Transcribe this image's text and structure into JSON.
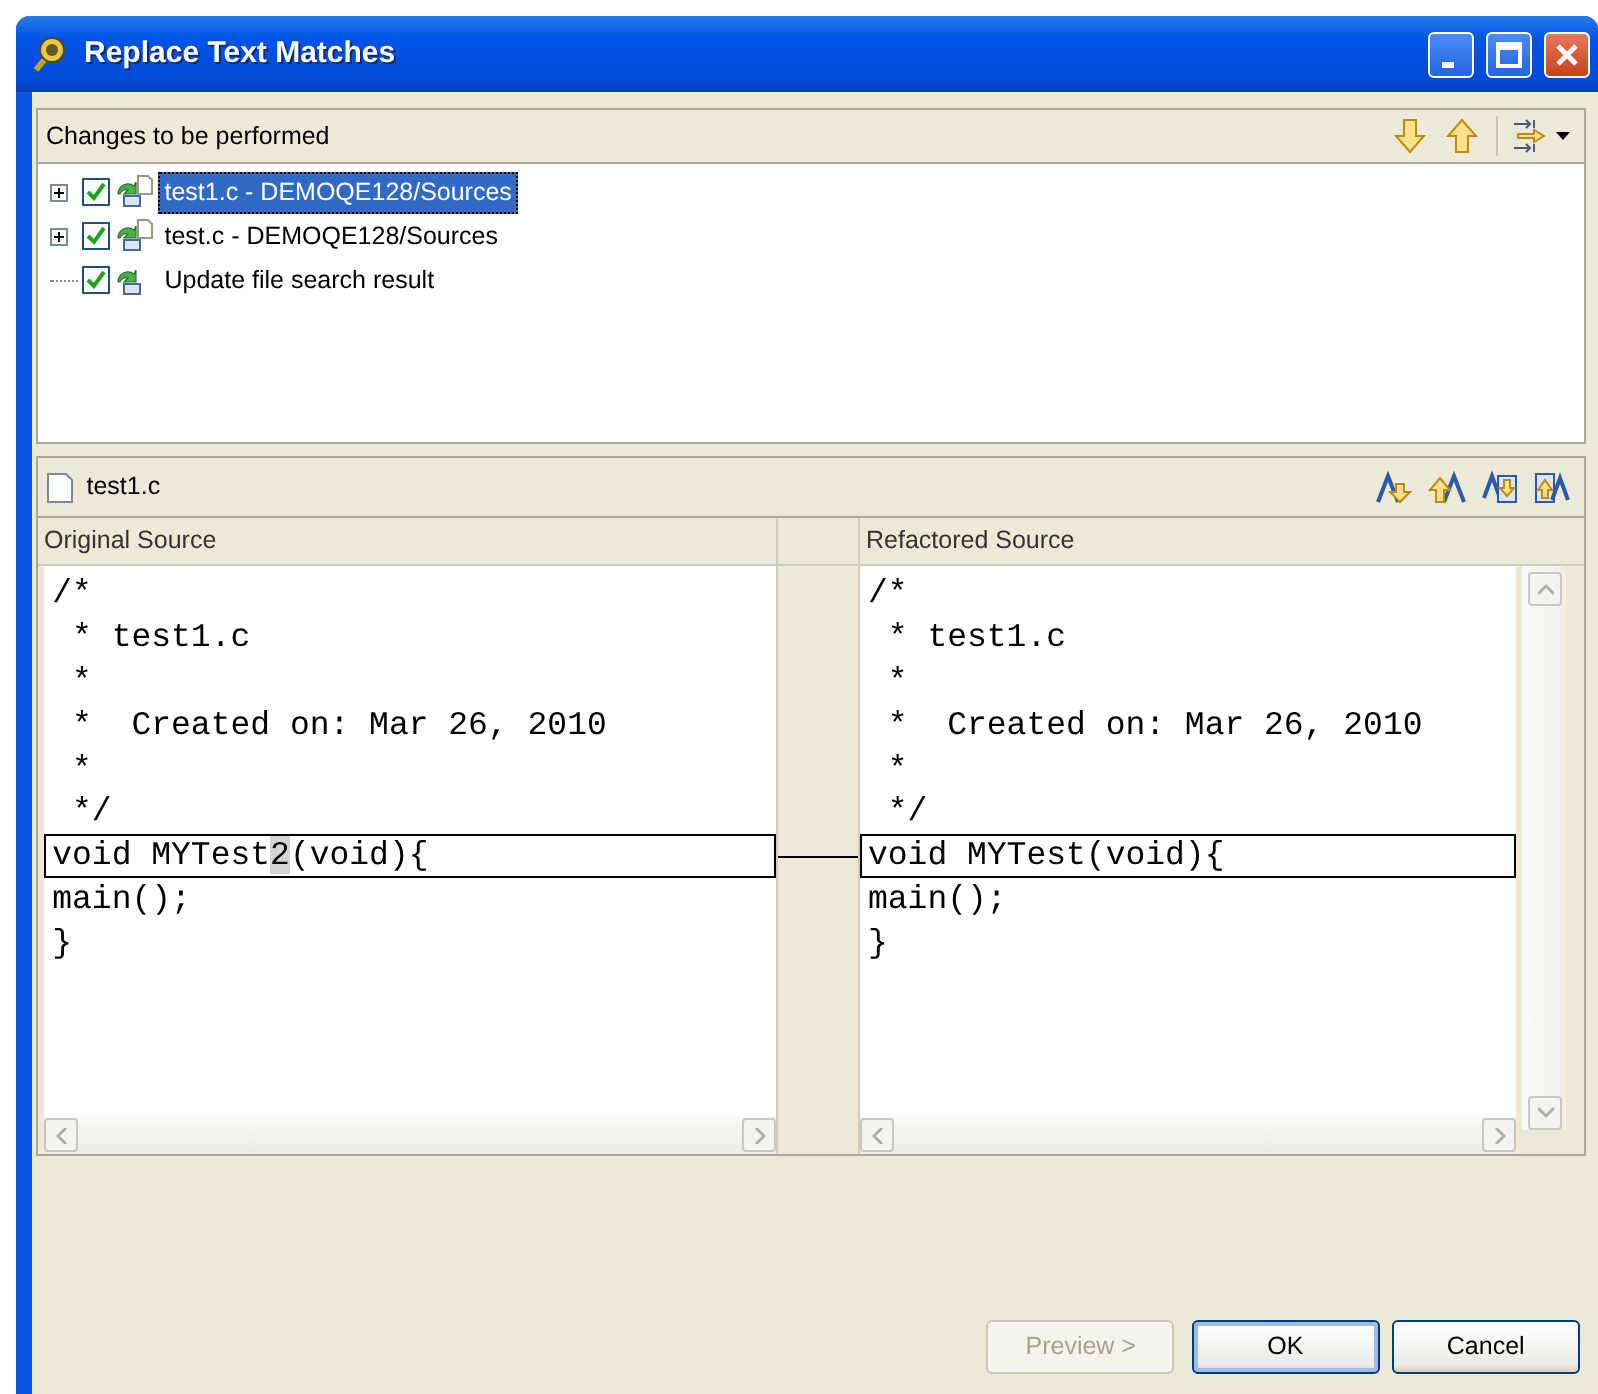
{
  "window": {
    "title": "Replace Text Matches"
  },
  "changes": {
    "title": "Changes to be performed",
    "tree": [
      {
        "label": "test1.c - DEMOQE128/Sources",
        "kind": "file",
        "expanded": false,
        "checked": true,
        "selected": true
      },
      {
        "label": "test.c - DEMOQE128/Sources",
        "kind": "file",
        "expanded": false,
        "checked": true,
        "selected": false
      },
      {
        "label": "Update file search result",
        "kind": "task",
        "checked": true,
        "selected": false
      }
    ]
  },
  "compare": {
    "file": "test1.c",
    "left": {
      "title": "Original Source",
      "lines": [
        {
          "segments": [
            {
              "text": "/*"
            }
          ],
          "changed": false
        },
        {
          "segments": [
            {
              "text": " * test1.c"
            }
          ],
          "changed": false
        },
        {
          "segments": [
            {
              "text": " *"
            }
          ],
          "changed": false
        },
        {
          "segments": [
            {
              "text": " *  Created on: Mar 26, 2010"
            }
          ],
          "changed": false
        },
        {
          "segments": [
            {
              "text": " *"
            }
          ],
          "changed": false
        },
        {
          "segments": [
            {
              "text": " */"
            }
          ],
          "changed": false
        },
        {
          "segments": [
            {
              "text": "void MYTest",
              "diff": false
            },
            {
              "text": "2",
              "diff": true
            },
            {
              "text": "(void){",
              "diff": false
            }
          ],
          "changed": true
        },
        {
          "segments": [
            {
              "text": "main();"
            }
          ],
          "changed": false
        },
        {
          "segments": [
            {
              "text": "}"
            }
          ],
          "changed": false
        }
      ]
    },
    "right": {
      "title": "Refactored Source",
      "lines": [
        {
          "segments": [
            {
              "text": "/*"
            }
          ],
          "changed": false
        },
        {
          "segments": [
            {
              "text": " * test1.c"
            }
          ],
          "changed": false
        },
        {
          "segments": [
            {
              "text": " *"
            }
          ],
          "changed": false
        },
        {
          "segments": [
            {
              "text": " *  Created on: Mar 26, 2010"
            }
          ],
          "changed": false
        },
        {
          "segments": [
            {
              "text": " *"
            }
          ],
          "changed": false
        },
        {
          "segments": [
            {
              "text": " */"
            }
          ],
          "changed": false
        },
        {
          "segments": [
            {
              "text": "void MYTest(void){"
            }
          ],
          "changed": true
        },
        {
          "segments": [
            {
              "text": "main();"
            }
          ],
          "changed": false
        },
        {
          "segments": [
            {
              "text": "}"
            }
          ],
          "changed": false
        }
      ]
    }
  },
  "buttons": [
    {
      "label": "Preview >",
      "disabled": true,
      "default": false
    },
    {
      "label": "OK",
      "disabled": false,
      "default": true
    },
    {
      "label": "Cancel",
      "disabled": false,
      "default": false
    }
  ]
}
